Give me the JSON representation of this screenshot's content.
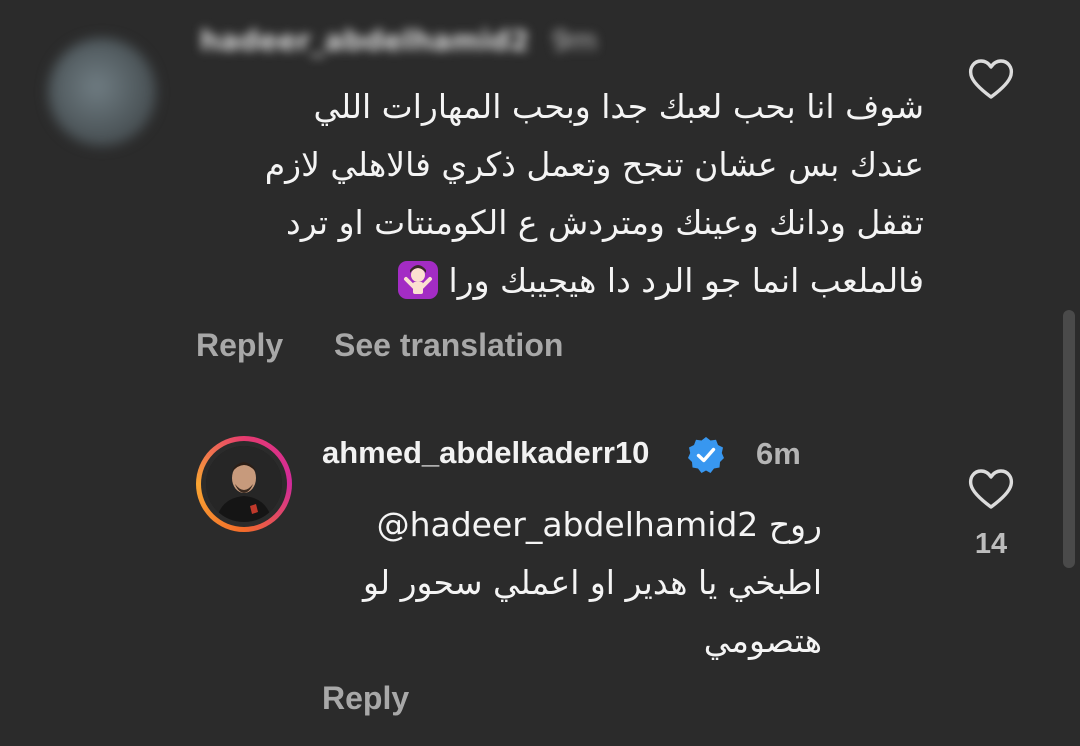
{
  "parent_comment": {
    "username": "hadeer_abdelhamid2",
    "time": "9m",
    "lines": [
      "شوف انا بحب لعبك جدا وبحب المهارات اللي",
      "عندك بس عشان تنجح وتعمل ذكري فالاهلي لازم",
      "تقفل ودانك وعينك ومتردش ع الكومنتات او ترد",
      "فالملعب انما جو الرد دا هيجيبك ورا"
    ],
    "emoji": "person-gesturing-no",
    "reply_label": "Reply",
    "translate_label": "See translation"
  },
  "reply_comment": {
    "username": "ahmed_abdelkaderr10",
    "verified": true,
    "time": "6m",
    "mention": "@hadeer_abdelhamid2",
    "line1_word": "روح",
    "lines": [
      "اطبخي يا هدير او اعملي سحور لو",
      "هتصومي"
    ],
    "likes": "14",
    "reply_label": "Reply"
  },
  "colors": {
    "background": "#2b2b2b",
    "text": "#f4f4f4",
    "muted": "#a8a8a8",
    "verified": "#3897f0",
    "emoji_bg": "#a32cc4"
  }
}
